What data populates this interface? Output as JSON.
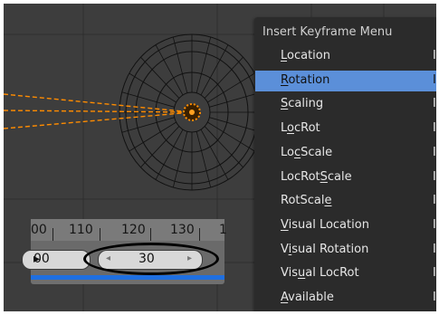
{
  "menu": {
    "title": "Insert Keyframe Menu",
    "items": [
      {
        "pre": "",
        "ul": "L",
        "post": "ocation",
        "shortcut": "I",
        "active": false
      },
      {
        "pre": "",
        "ul": "R",
        "post": "otation",
        "shortcut": "I",
        "active": true
      },
      {
        "pre": "",
        "ul": "S",
        "post": "caling",
        "shortcut": "I",
        "active": false
      },
      {
        "pre": "L",
        "ul": "o",
        "post": "cRot",
        "shortcut": "I",
        "active": false
      },
      {
        "pre": "Lo",
        "ul": "c",
        "post": "Scale",
        "shortcut": "I",
        "active": false
      },
      {
        "pre": "LocRot",
        "ul": "S",
        "post": "cale",
        "shortcut": "I",
        "active": false
      },
      {
        "pre": "RotScal",
        "ul": "e",
        "post": "",
        "shortcut": "I",
        "active": false
      },
      {
        "pre": "",
        "ul": "V",
        "post": "isual Location",
        "shortcut": "I",
        "active": false
      },
      {
        "pre": "V",
        "ul": "i",
        "post": "sual Rotation",
        "shortcut": "I",
        "active": false
      },
      {
        "pre": "Vis",
        "ul": "u",
        "post": "al LocRot",
        "shortcut": "I",
        "active": false
      },
      {
        "pre": "",
        "ul": "A",
        "post": "vailable",
        "shortcut": "I",
        "active": false
      }
    ]
  },
  "timeline": {
    "ticks": [
      "00",
      "110",
      "120",
      "130",
      "1"
    ],
    "prev_field": "00",
    "frame": "30",
    "frame_arrow_left": "◂",
    "frame_arrow_right": "▸"
  },
  "colors": {
    "viewport_bg": "#3d3d3d",
    "menu_bg": "#2b2b2b",
    "menu_highlight": "#5b8fd9",
    "timeline_blue": "#1f6fe0",
    "origin_orange": "#ff8c00"
  }
}
